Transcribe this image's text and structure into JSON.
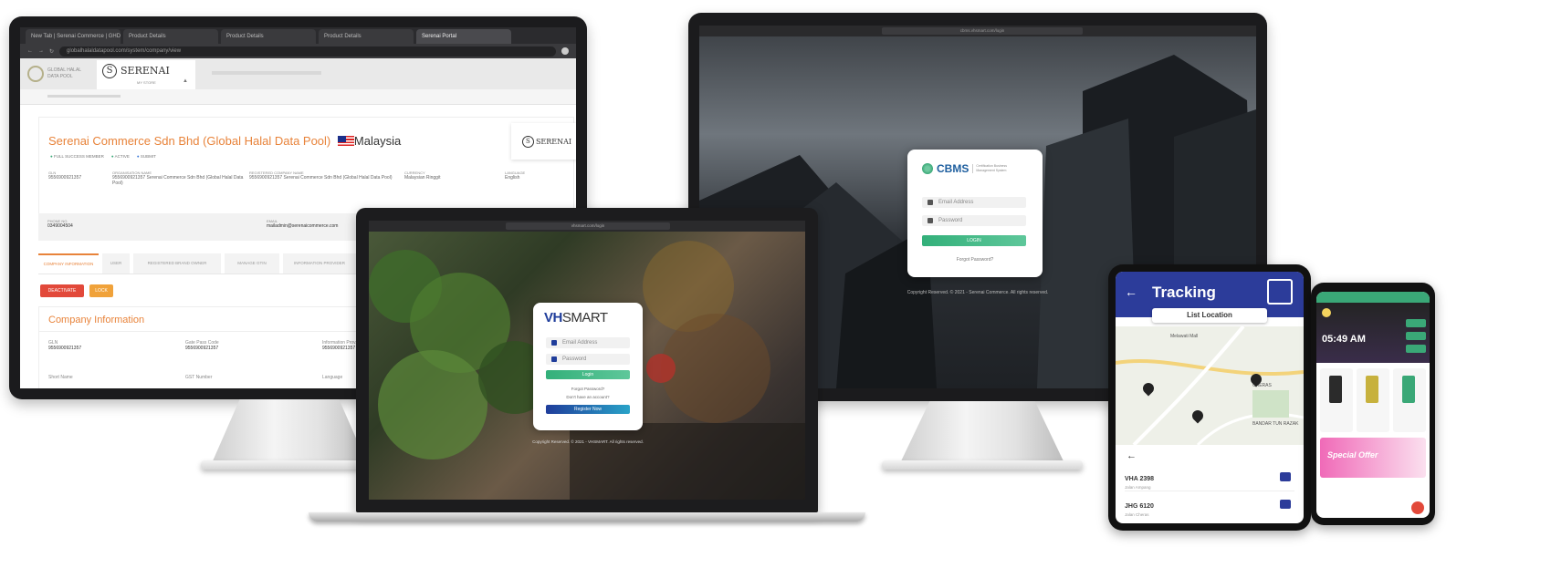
{
  "left_monitor": {
    "tabs": [
      "New Tab | Serenai Commerce | GHD Halal",
      "Product Details",
      "Product Details",
      "Product Details",
      "Serenai Portal"
    ],
    "url": "globalhalaldatapool.com/system/company/view",
    "logo_left": "GLOBAL HALAL DATA POOL",
    "brand": "SERENAI",
    "brand_sub": "MY STORE",
    "company_title": "Serenai Commerce Sdn Bhd (Global Halal Data Pool)",
    "country": "Malaysia",
    "badges": [
      "FULL SUCCESS MEMBER",
      "ACTIVE",
      "SUBMIT"
    ],
    "info_cols": [
      {
        "label": "GLN",
        "value": "9556900921357"
      },
      {
        "label": "ORGANISATION NAME",
        "value": "9556900921357 Serenai Commerce Sdn Bhd (Global Halal Data Pool)"
      },
      {
        "label": "REGISTERED COMPANY NAME",
        "value": "9556900921357 Serenai Commerce Sdn Bhd (Global Halal Data Pool)"
      },
      {
        "label": "CURRENCY",
        "value": "Malaysian Ringgit"
      },
      {
        "label": "LANGUAGE",
        "value": "English"
      }
    ],
    "phone_label": "PHONE NO.",
    "phone": "0349004504",
    "email_label": "EMAIL",
    "email": "mailadmin@serenaicommerce.com",
    "subtabs": [
      "COMPANY INFORMATION",
      "USER",
      "REGISTERED BRAND OWNER",
      "MANAGE GTIN",
      "INFORMATION PROVIDER"
    ],
    "btn_deactivate": "DEACTIVATE",
    "btn_lock": "LOCK",
    "section_title": "Company Information",
    "fields": [
      {
        "label": "GLN",
        "value": "9556900921357"
      },
      {
        "label": "Gate Pass Code",
        "value": "9556900921357"
      },
      {
        "label": "Information Prov.",
        "value": "9556900921357"
      }
    ],
    "fields2": [
      "Short Name",
      "GST Number",
      "Language"
    ]
  },
  "right_monitor": {
    "url": "cbms.vhsmart.com/login",
    "logo": "CBMS",
    "logo_sub": "Certification Business Management System",
    "email_placeholder": "Email Address",
    "password_placeholder": "Password",
    "login": "LOGIN",
    "forgot": "Forgot Password?",
    "footer": "Copyright Reserved. © 2021 - Serenai Commerce. All rights reserved."
  },
  "laptop": {
    "url": "vhsmart.com/login",
    "logo_vh": "VH",
    "logo_smart": "SMART",
    "email_placeholder": "Email Address",
    "password_placeholder": "Password",
    "login": "Login",
    "forgot": "Forgot Password?",
    "no_account": "Don't have an account?",
    "register": "Register Now",
    "footer": "Copyright Reserved. © 2021 - VHSMART. All rights reserved."
  },
  "tablet": {
    "title": "Tracking",
    "tab": "List Location",
    "map_labels": [
      "Melawati Mall",
      "CHERAS",
      "BANDAR TUN RAZAK"
    ],
    "items": [
      {
        "plate": "VHA 2398",
        "sub": "Jalan Ampang"
      },
      {
        "plate": "JHG 6120",
        "sub": "Jalan Cheras"
      }
    ]
  },
  "phone": {
    "time": "05:49 AM",
    "promo": "Special Offer"
  },
  "colors": {
    "serenai_accent": "#e8833a",
    "cbms_green": "#3aa877",
    "vh_blue": "#1f3d9b",
    "tracking_blue": "#2c3c9a"
  }
}
